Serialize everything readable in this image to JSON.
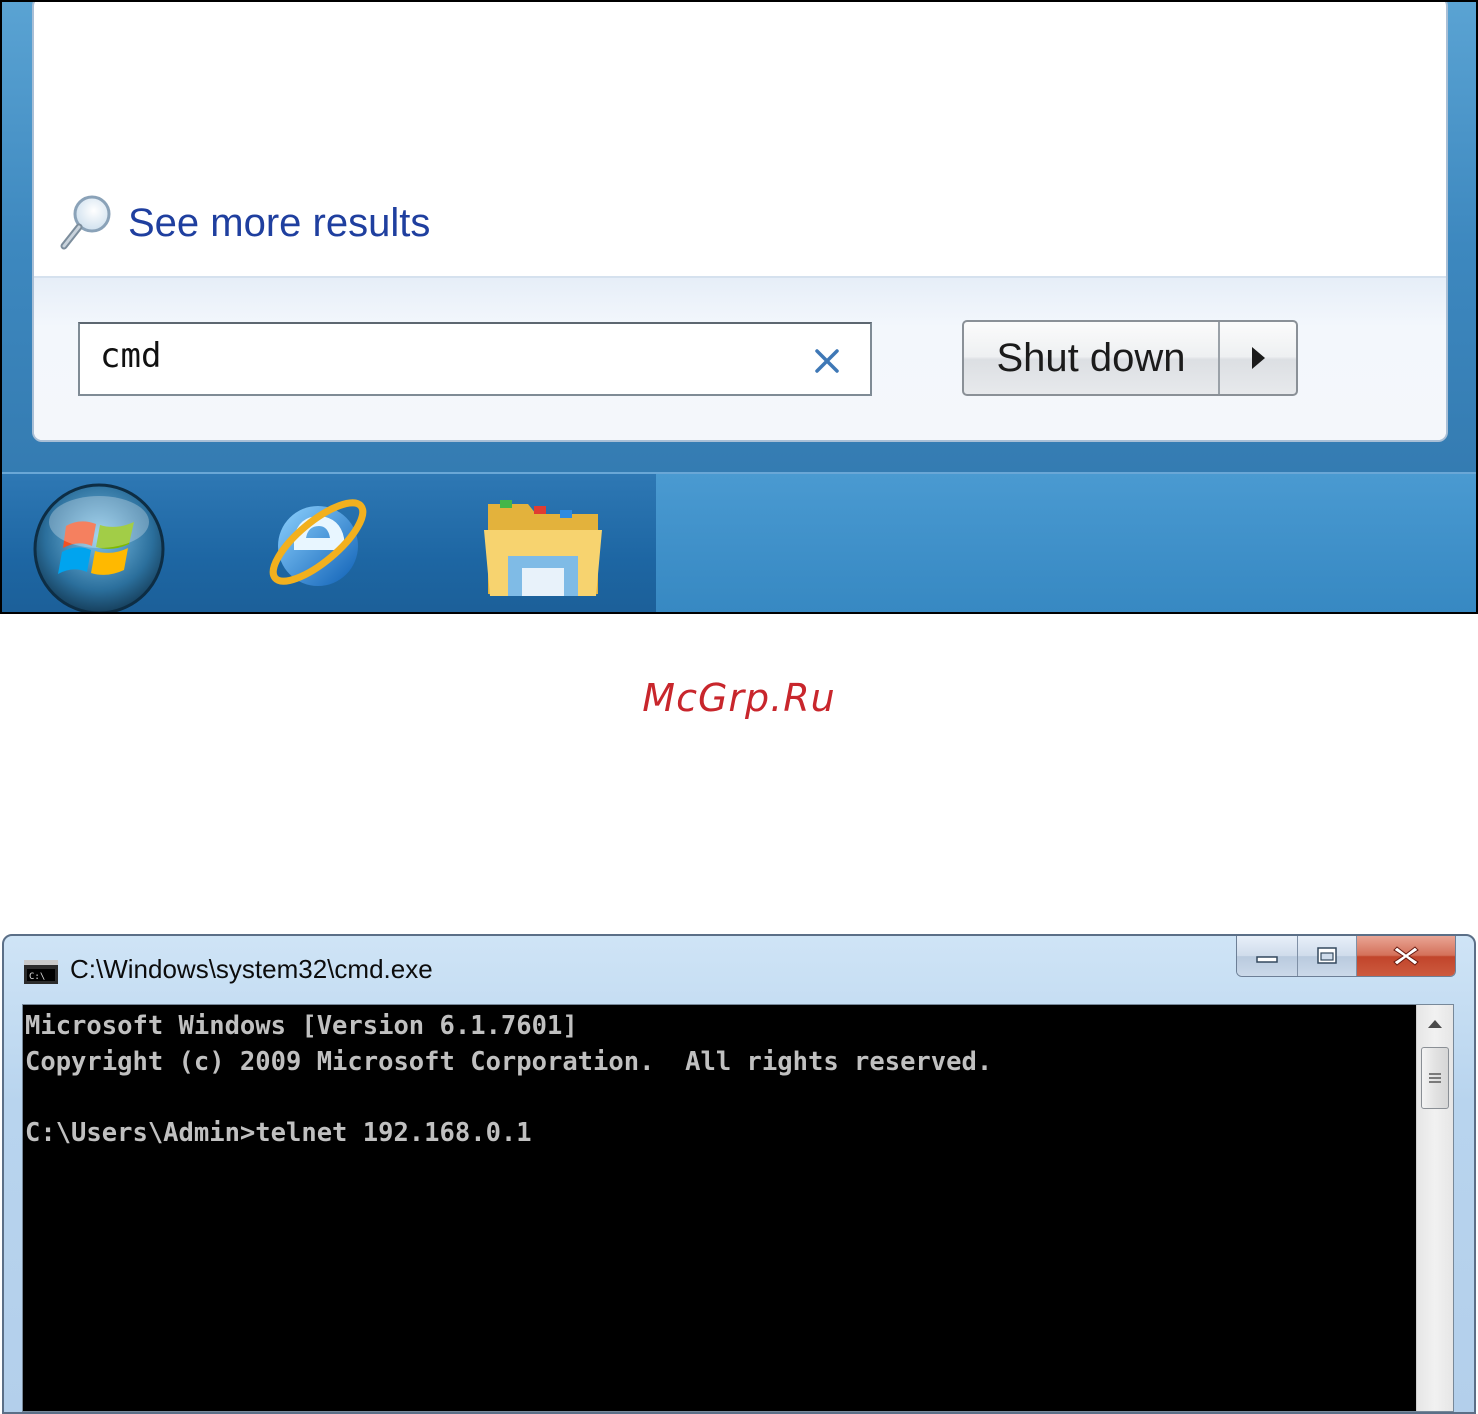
{
  "start_menu": {
    "see_more_label": "See more results",
    "search": {
      "value": "cmd"
    },
    "shutdown_label": "Shut down"
  },
  "taskbar": {
    "items": [
      {
        "name": "start-orb",
        "icon": "windows-logo-icon"
      },
      {
        "name": "internet-explorer",
        "icon": "internet-explorer-icon"
      },
      {
        "name": "windows-explorer",
        "icon": "folder-icon"
      }
    ]
  },
  "watermark": "McGrp.Ru",
  "cmd_window": {
    "title": "C:\\Windows\\system32\\cmd.exe",
    "console_lines": [
      "Microsoft Windows [Version 6.1.7601]",
      "Copyright (c) 2009 Microsoft Corporation.  All rights reserved.",
      "",
      "C:\\Users\\Admin>telnet 192.168.0.1"
    ]
  },
  "colors": {
    "link_blue": "#1f3f9f",
    "taskbar_blue": "#1d66a3",
    "watermark_red": "#c8262c",
    "close_red": "#c1452b"
  }
}
